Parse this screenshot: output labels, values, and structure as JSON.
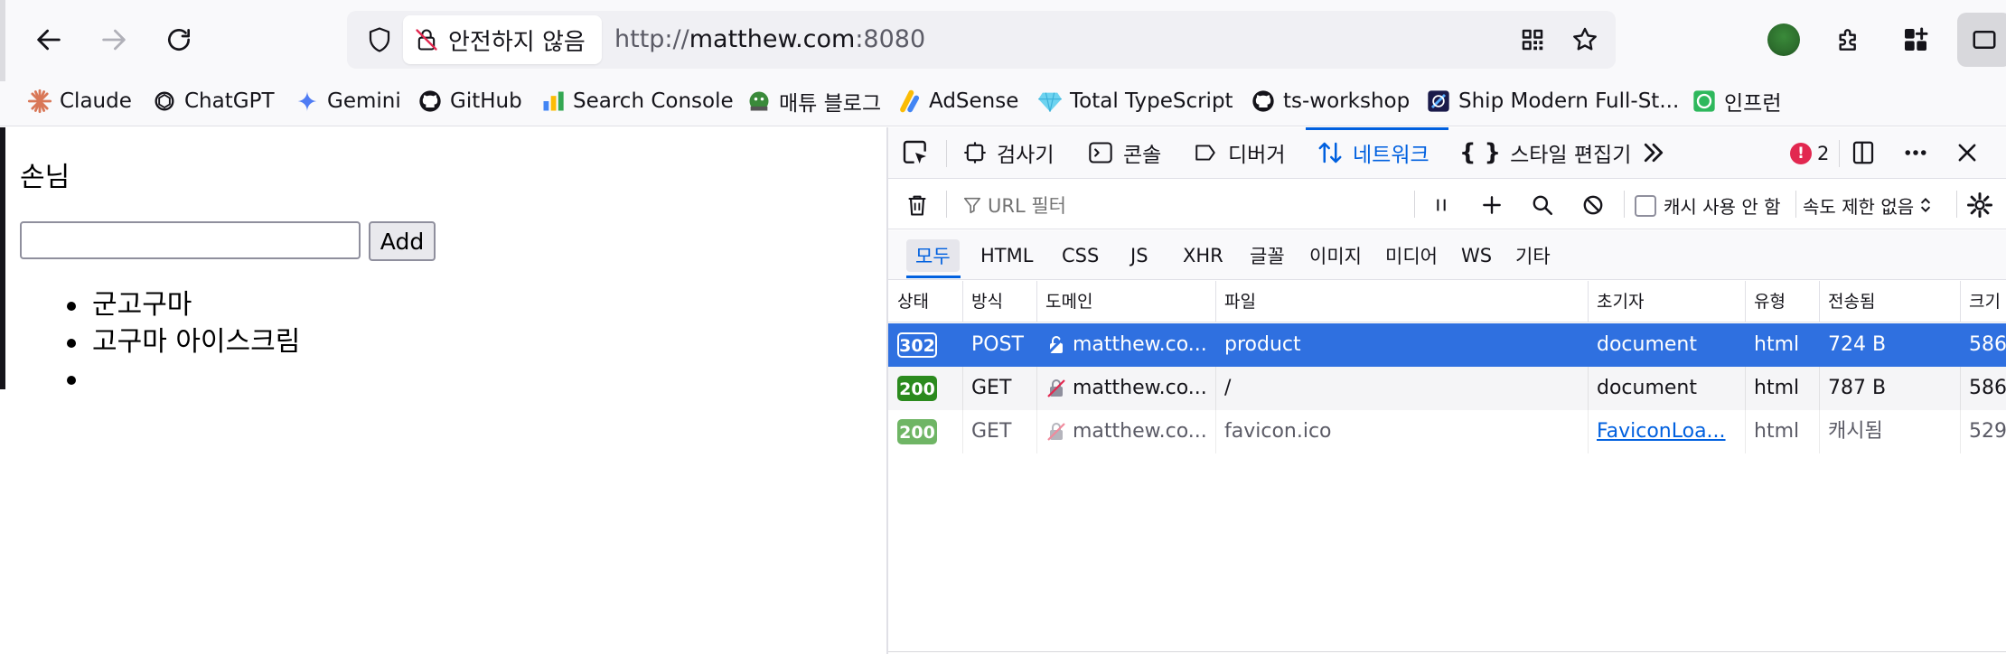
{
  "browser": {
    "insecure_label": "안전하지 않음",
    "url_scheme": "http://",
    "url_host": "matthew.com",
    "url_port": ":8080"
  },
  "bookmarks": [
    {
      "label": "Claude",
      "icon": "claude-icon"
    },
    {
      "label": "ChatGPT",
      "icon": "chatgpt-icon"
    },
    {
      "label": "Gemini",
      "icon": "gemini-icon"
    },
    {
      "label": "GitHub",
      "icon": "github-icon"
    },
    {
      "label": "Search Console",
      "icon": "search-console-icon"
    },
    {
      "label": "매튜 블로그",
      "icon": "blog-icon"
    },
    {
      "label": "AdSense",
      "icon": "adsense-icon"
    },
    {
      "label": "Total TypeScript",
      "icon": "gem-icon"
    },
    {
      "label": "ts-workshop",
      "icon": "github-icon"
    },
    {
      "label": "Ship Modern Full-St...",
      "icon": "ship-icon"
    },
    {
      "label": "인프런",
      "icon": "inflearn-icon"
    }
  ],
  "page": {
    "heading": "손님",
    "input_value": "",
    "add_label": "Add",
    "items": [
      "군고구마",
      "고구마 아이스크림",
      ""
    ]
  },
  "devtools": {
    "tabs": {
      "inspector": "검사기",
      "console": "콘솔",
      "debugger": "디버거",
      "network": "네트워크",
      "style_editor": "스타일 편집기"
    },
    "error_count": "2",
    "filter_placeholder": "URL 필터",
    "cache_label": "캐시 사용 안 함",
    "throttle_label": "속도 제한 없음",
    "types": [
      "모두",
      "HTML",
      "CSS",
      "JS",
      "XHR",
      "글꼴",
      "이미지",
      "미디어",
      "WS",
      "기타"
    ],
    "columns": [
      "상태",
      "방식",
      "도메인",
      "파일",
      "초기자",
      "유형",
      "전송됨",
      "크기"
    ],
    "rows": [
      {
        "status": "302",
        "method": "POST",
        "domain": "matthew.co...",
        "file": "product",
        "initiator": "document",
        "type": "html",
        "transferred": "724 B",
        "size": "586"
      },
      {
        "status": "200",
        "method": "GET",
        "domain": "matthew.co...",
        "file": "/",
        "initiator": "document",
        "type": "html",
        "transferred": "787 B",
        "size": "586"
      },
      {
        "status": "200",
        "method": "GET",
        "domain": "matthew.co...",
        "file": "favicon.ico",
        "initiator": "FaviconLoa...",
        "type": "html",
        "transferred": "캐시됨",
        "size": "529"
      }
    ],
    "colors": {
      "accent": "#0060df",
      "selected_row": "#2f70e0",
      "status_ok": "#2b8a1e",
      "error": "#e22850"
    }
  }
}
